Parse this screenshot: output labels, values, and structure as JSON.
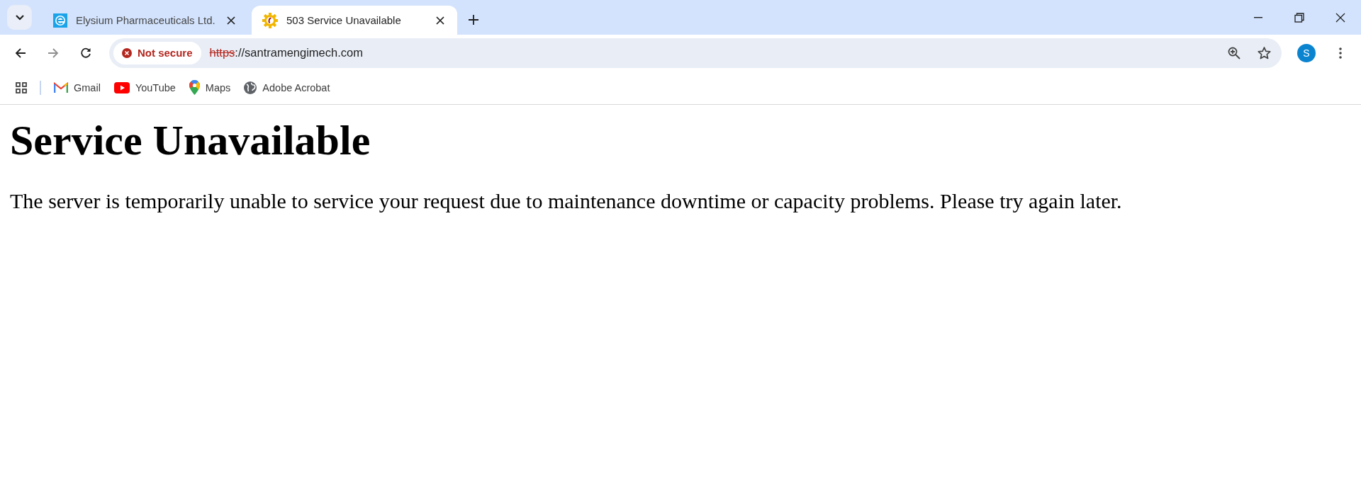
{
  "tabs": [
    {
      "title": "Elysium Pharmaceuticals Ltd.",
      "kind": "e-logo",
      "selected": false
    },
    {
      "title": "503 Service Unavailable",
      "kind": "gear",
      "selected": true
    }
  ],
  "toolbar": {
    "security_label": "Not secure",
    "url_scheme": "https",
    "url_rest": "://santramengimech.com",
    "profile_initial": "S"
  },
  "bookmarks": [
    {
      "label": "Gmail",
      "kind": "gmail"
    },
    {
      "label": "YouTube",
      "kind": "youtube"
    },
    {
      "label": "Maps",
      "kind": "maps"
    },
    {
      "label": "Adobe Acrobat",
      "kind": "globe"
    }
  ],
  "page": {
    "heading": "Service Unavailable",
    "message": "The server is temporarily unable to service your request due to maintenance downtime or capacity problems. Please try again later."
  }
}
